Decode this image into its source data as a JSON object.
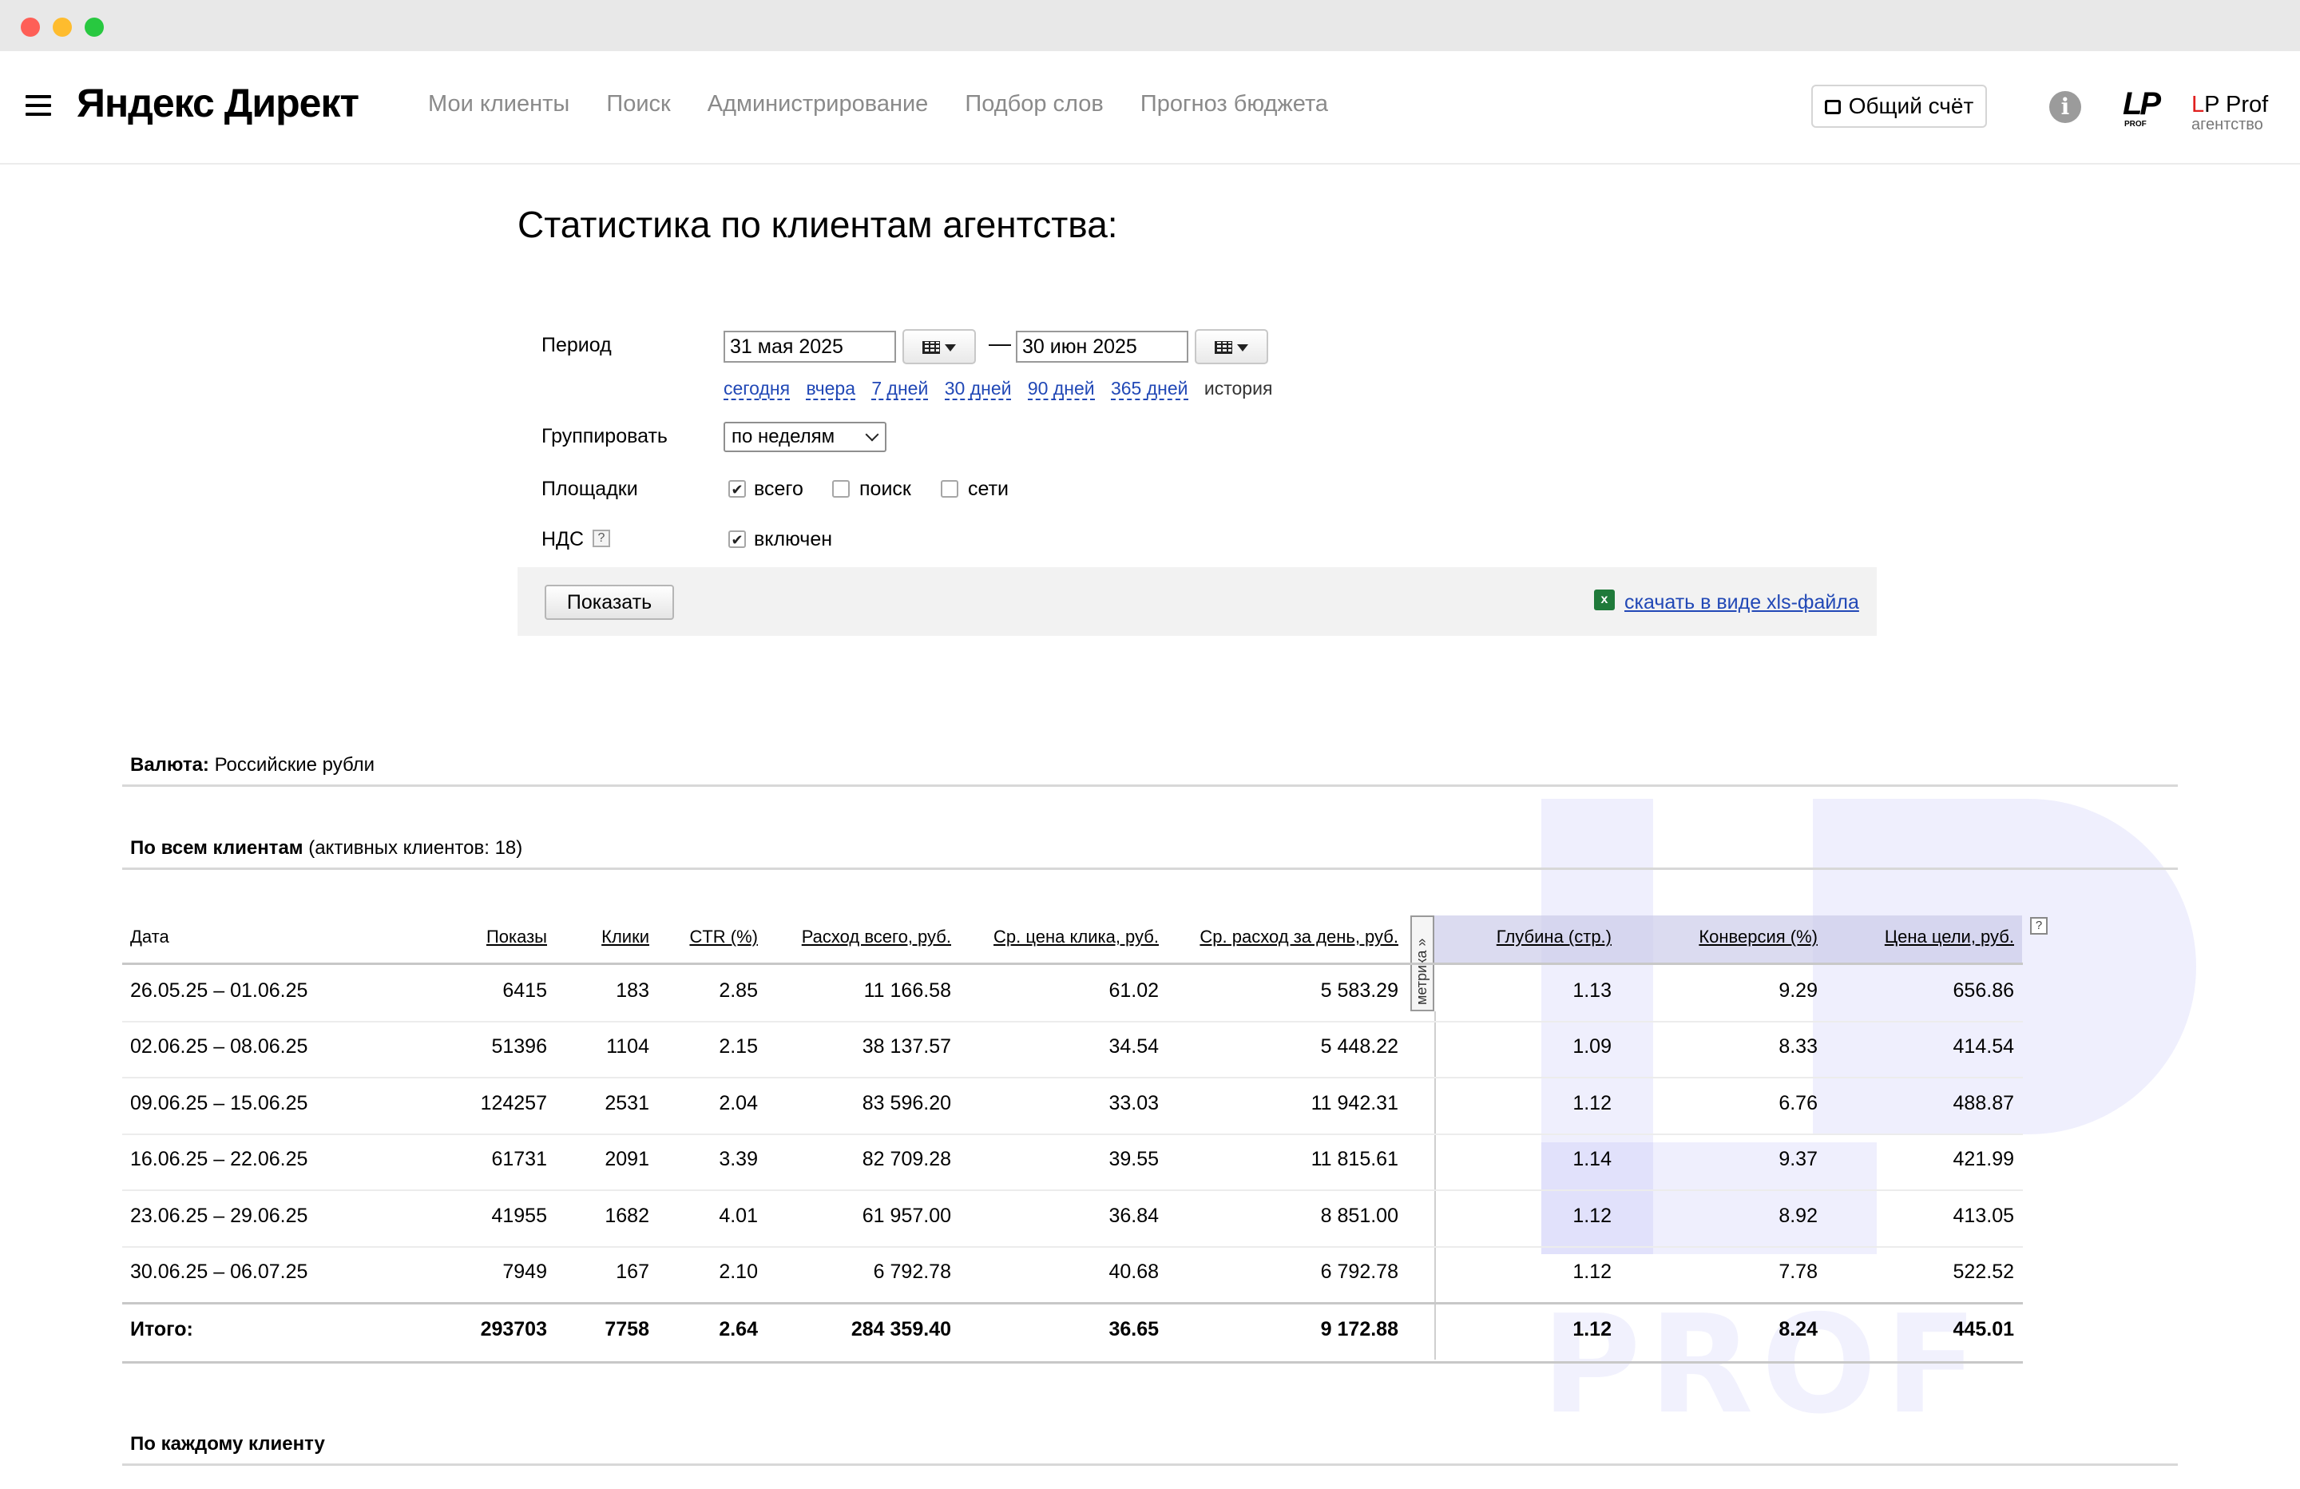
{
  "header": {
    "brand": "Яндекс Директ",
    "nav": [
      "Мои клиенты",
      "Поиск",
      "Администрирование",
      "Подбор слов",
      "Прогноз бюджета"
    ],
    "account_button": "Общий счёт",
    "info_icon": "i",
    "lp_logo": "LP",
    "lp_logo_sub": "PROF",
    "agency_name_l": "L",
    "agency_name_rest": "P Prof",
    "agency_sub": "агентство"
  },
  "page": {
    "title": "Статистика по клиентам агентства:"
  },
  "form": {
    "period_label": "Период",
    "date_from": "31 мая 2025",
    "date_to": "30 июн 2025",
    "dash": "—",
    "quick_links": [
      "сегодня",
      "вчера",
      "7 дней",
      "30 дней",
      "90 дней",
      "365 дней"
    ],
    "history": "история",
    "group_label": "Группировать",
    "group_value": "по неделям",
    "places_label": "Площадки",
    "places": [
      {
        "label": "всего",
        "checked": true
      },
      {
        "label": "поиск",
        "checked": false
      },
      {
        "label": "сети",
        "checked": false
      }
    ],
    "vat_label": "НДС",
    "vat_help": "?",
    "vat_option": "включен",
    "check_mark": "✔",
    "show_button": "Показать",
    "xls_link": "скачать в виде xls-файла",
    "xls_icon": "x"
  },
  "currency": {
    "label": "Валюта:",
    "value": "Российские рубли"
  },
  "all_clients": {
    "label": "По всем клиентам",
    "note": "(активных клиентов: 18)"
  },
  "table": {
    "metrika_tab": "метрика »",
    "help": "?",
    "columns": [
      "Дата",
      "Показы",
      "Клики",
      "CTR (%)",
      "Расход всего, руб.",
      "Ср. цена клика, руб.",
      "Ср. расход за день, руб.",
      "Глубина (стр.)",
      "Конверсия (%)",
      "Цена цели, руб."
    ],
    "rows": [
      [
        "26.05.25 – 01.06.25",
        "6415",
        "183",
        "2.85",
        "11 166.58",
        "61.02",
        "5 583.29",
        "1.13",
        "9.29",
        "656.86"
      ],
      [
        "02.06.25 – 08.06.25",
        "51396",
        "1104",
        "2.15",
        "38 137.57",
        "34.54",
        "5 448.22",
        "1.09",
        "8.33",
        "414.54"
      ],
      [
        "09.06.25 – 15.06.25",
        "124257",
        "2531",
        "2.04",
        "83 596.20",
        "33.03",
        "11 942.31",
        "1.12",
        "6.76",
        "488.87"
      ],
      [
        "16.06.25 – 22.06.25",
        "61731",
        "2091",
        "3.39",
        "82 709.28",
        "39.55",
        "11 815.61",
        "1.14",
        "9.37",
        "421.99"
      ],
      [
        "23.06.25 – 29.06.25",
        "41955",
        "1682",
        "4.01",
        "61 957.00",
        "36.84",
        "8 851.00",
        "1.12",
        "8.92",
        "413.05"
      ],
      [
        "30.06.25 – 06.07.25",
        "7949",
        "167",
        "2.10",
        "6 792.78",
        "40.68",
        "6 792.78",
        "1.12",
        "7.78",
        "522.52"
      ]
    ],
    "total": [
      "Итого:",
      "293703",
      "7758",
      "2.64",
      "284 359.40",
      "36.65",
      "9 172.88",
      "1.12",
      "8.24",
      "445.01"
    ]
  },
  "each_client": {
    "label": "По каждому клиенту"
  },
  "watermark": {
    "text": "PROF"
  }
}
